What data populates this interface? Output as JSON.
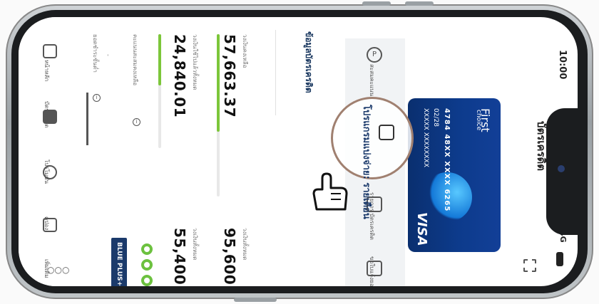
{
  "status_bar": {
    "time": "10:00",
    "signal": "4G"
  },
  "header": {
    "title": "บัตรเครดิต"
  },
  "card": {
    "brand": "First",
    "brand_sub": "choice",
    "number": "4784 48XX XXXX 6265",
    "expiry": "02/28",
    "holder": "XXXXX XXXXXXXX",
    "network": "VISA"
  },
  "actions": [
    {
      "label": "สะสมคะแนน",
      "icon": "points-icon"
    },
    {
      "label": "โปรแกรมแบ่งจ่าย: รายเดือน",
      "icon": "installment-icon"
    },
    {
      "label": "รายการ บัตรเครดิต",
      "icon": "statement-icon"
    },
    {
      "label": "ขอใบแจ้งยอด อีเมลล์",
      "icon": "document-icon"
    }
  ],
  "info": {
    "title": "ข้อมูลบัตรเครดิต",
    "available_label": "วงเงินคงเหลือ",
    "available_value": "57,663.37",
    "total_label": "วงเงินทั้งหมด",
    "total_value": "95,600",
    "used_label": "วงเงินใช้ไปแล้วทั้งหมด",
    "used_value": "24,840.01",
    "limit_label": "วงเงินทั้งหมด",
    "limit_value": "55,400",
    "available_progress": 0.6,
    "used_progress": 0.45,
    "points_label": "คะแนนสะสมคงเหลือ",
    "points_value": "-",
    "min_label": "ยอดชำระขั้นต่ำ",
    "badge": "BLUE PLUS+"
  },
  "tabs": [
    {
      "label": "หน้าหลัก",
      "icon": "home-icon"
    },
    {
      "label": "บัตรเครดิต",
      "icon": "card-icon"
    },
    {
      "label": "โปรโมชั่น",
      "icon": "tag-icon"
    },
    {
      "label": "คูปอง",
      "icon": "coupon-icon"
    },
    {
      "label": "เพิ่มเติม",
      "icon": "more-icon"
    }
  ],
  "colors": {
    "brand": "#1b3a6b",
    "progress": "#7cc63a",
    "card": "#0d3b8c"
  }
}
